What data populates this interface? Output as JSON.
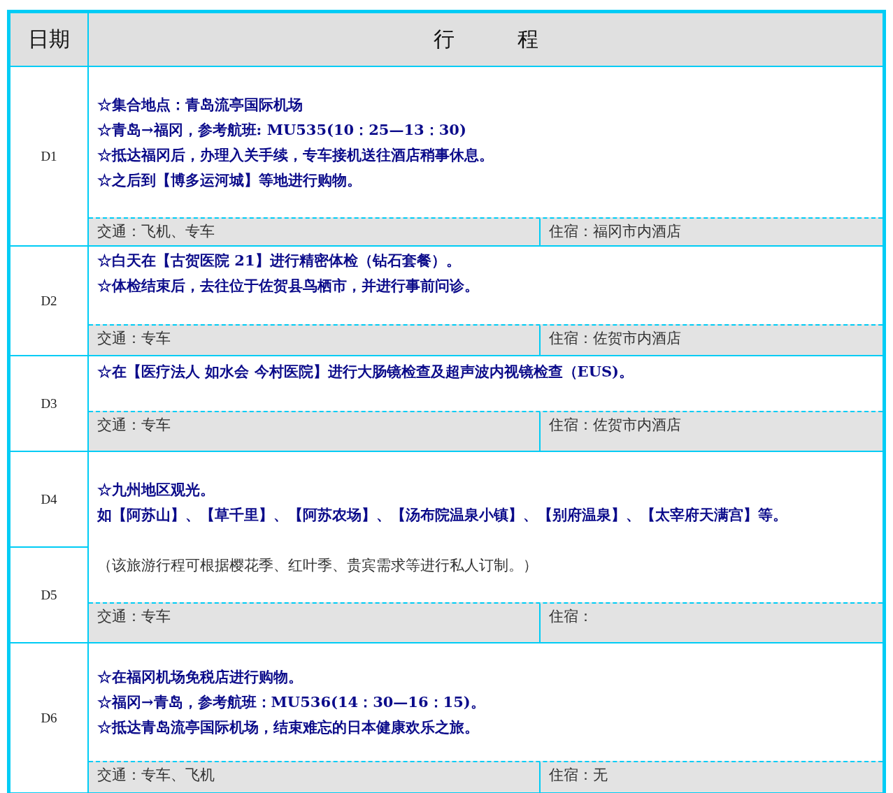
{
  "header": {
    "date": "日期",
    "itinerary": "行　　　程"
  },
  "days": [
    {
      "dates": [
        "D1"
      ],
      "lines": [
        {
          "kind": "highlight",
          "text": "☆集合地点：青岛流亭国际机场"
        },
        {
          "kind": "highlight",
          "text": "☆青岛→福冈，参考航班: MU535(10：25—13：30)"
        },
        {
          "kind": "highlight",
          "text": "☆抵达福冈后，办理入关手续，专车接机送往酒店稍事休息。"
        },
        {
          "kind": "highlight",
          "text": "☆之后到【博多运河城】等地进行购物。"
        }
      ],
      "transport": "交通：飞机、专车",
      "lodging": "住宿：福冈市内酒店"
    },
    {
      "dates": [
        "D2"
      ],
      "lines": [
        {
          "kind": "highlight",
          "text": "☆白天在【古贺医院 21】进行精密体检（钻石套餐）。"
        },
        {
          "kind": "highlight",
          "text": "☆体检结束后，去往位于佐贺县鸟栖市，并进行事前问诊。"
        }
      ],
      "transport": "交通：专车",
      "lodging": "住宿：佐贺市内酒店"
    },
    {
      "dates": [
        "D3"
      ],
      "lines": [
        {
          "kind": "highlight",
          "text": "☆在【医疗法人 如水会 今村医院】进行大肠镜检查及超声波内视镜检查（EUS)。"
        }
      ],
      "transport": "交通：专车",
      "lodging": "住宿：佐贺市内酒店"
    },
    {
      "dates": [
        "D4",
        "D5"
      ],
      "lines": [
        {
          "kind": "highlight",
          "text": "☆九州地区观光。"
        },
        {
          "kind": "highlight",
          "text": "如【阿苏山】、【草千里】、【阿苏农场】、【汤布院温泉小镇】、【别府温泉】、【太宰府天满宫】等。"
        },
        {
          "kind": "note",
          "text": "（该旅游行程可根据樱花季、红叶季、贵宾需求等进行私人订制。）"
        }
      ],
      "transport": "交通：专车",
      "lodging": "住宿："
    },
    {
      "dates": [
        "D6"
      ],
      "lines": [
        {
          "kind": "highlight",
          "text": "☆在福冈机场免税店进行购物。"
        },
        {
          "kind": "highlight",
          "text": "☆福冈→青岛，参考航班：MU536(14：30—16：15)。"
        },
        {
          "kind": "highlight",
          "text": "☆抵达青岛流亭国际机场，结束难忘的日本健康欢乐之旅。"
        }
      ],
      "transport": "交通：专车、飞机",
      "lodging": "住宿：无"
    }
  ]
}
